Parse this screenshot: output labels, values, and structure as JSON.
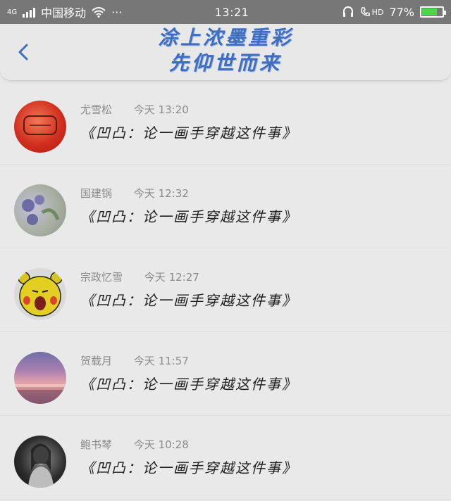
{
  "status_bar": {
    "network": "4G",
    "carrier": "中国移动",
    "more_dots": "···",
    "time": "13:21",
    "hd": "HD",
    "battery": "77%",
    "battery_level": 0.77
  },
  "header": {
    "title_line1": "涂上浓墨重彩",
    "title_line2": "先仰世而来"
  },
  "colors": {
    "accent": "#3f6dbf",
    "battery_green": "#4fd44f"
  },
  "items": [
    {
      "name": "尤雪松",
      "time": "今天 13:20",
      "title": "《凹凸：论一画手穿越这件事》"
    },
    {
      "name": "国建锅",
      "time": "今天 12:32",
      "title": "《凹凸：论一画手穿越这件事》"
    },
    {
      "name": "宗政忆雪",
      "time": "今天 12:27",
      "title": "《凹凸：论一画手穿越这件事》"
    },
    {
      "name": "贺载月",
      "time": "今天 11:57",
      "title": "《凹凸：论一画手穿越这件事》"
    },
    {
      "name": "鲍书琴",
      "time": "今天 10:28",
      "title": "《凹凸：论一画手穿越这件事》"
    }
  ]
}
